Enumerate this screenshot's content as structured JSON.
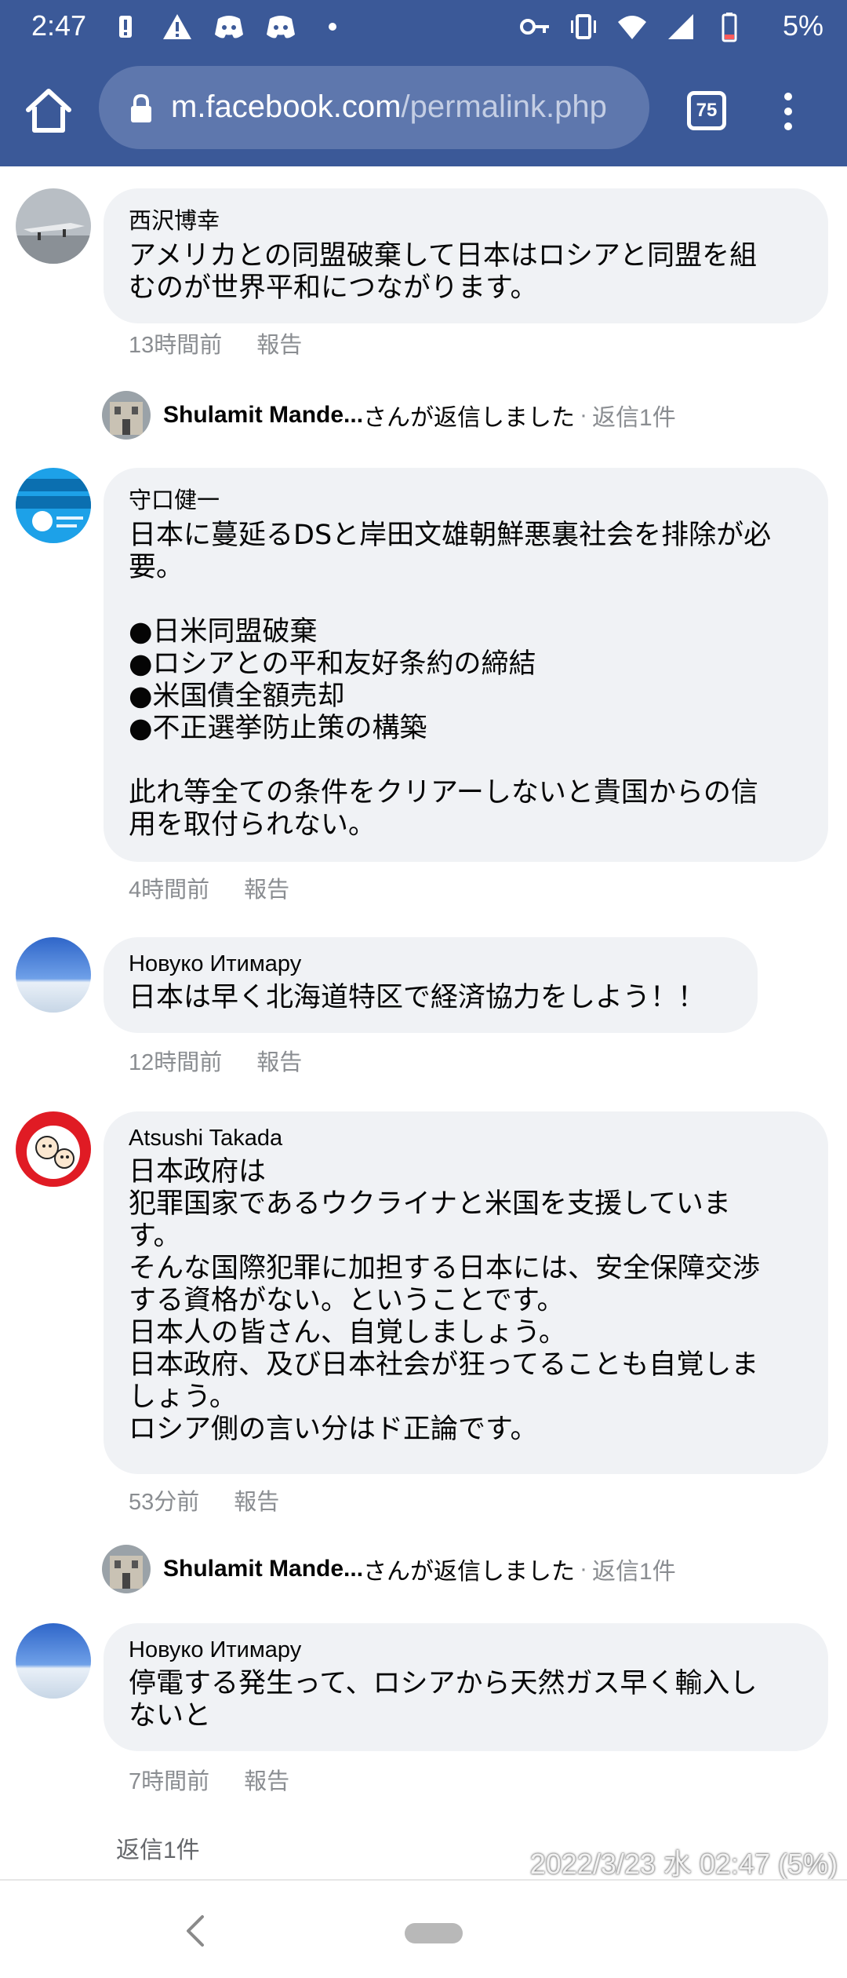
{
  "status_bar": {
    "time": "2:47",
    "battery": "5%",
    "left_icons": [
      "alert-battery-icon",
      "warning-icon",
      "discord-icon",
      "discord-icon",
      "dot-icon"
    ],
    "right_icons": [
      "key-icon",
      "vibrate-icon",
      "wifi-icon",
      "signal-icon",
      "battery-low-icon"
    ]
  },
  "browser": {
    "url_domain": "m.facebook.com",
    "url_path": "/permalink.php",
    "tab_count": "75"
  },
  "comments": [
    {
      "author": "西沢博幸",
      "text": "アメリカとの同盟破棄して日本はロシアと同盟を組\nむのが世界平和につながります。",
      "time": "13時間前",
      "report": "報告"
    },
    {
      "author": "守口健一",
      "text": "日本に蔓延るDSと岸田文雄朝鮮悪裏社会を排除が必\n要。\n\n●日米同盟破棄\n●ロシアとの平和友好条約の締結\n●米国債全額売却\n●不正選挙防止策の構築\n\n此れ等全ての条件をクリアーしないと貴国からの信\n用を取付られない。",
      "time": "4時間前",
      "report": "報告"
    },
    {
      "author": "Новуко Итимару",
      "text": "日本は早く北海道特区で経済協力をしよう！！",
      "time": "12時間前",
      "report": "報告"
    },
    {
      "author": "Atsushi Takada",
      "text": "日本政府は\n犯罪国家であるウクライナと米国を支援していま\nす。\nそんな国際犯罪に加担する日本には、安全保障交渉\nする資格がない。ということです。\n日本人の皆さん、自覚しましょう。\n日本政府、及び日本社会が狂ってることも自覚しま\nしょう。\nロシア側の言い分はド正論です。",
      "time": "53分前",
      "report": "報告"
    },
    {
      "author": "Новуко Итимару",
      "text": "停電する発生って、ロシアから天然ガス早く輸入し\nないと",
      "time": "7時間前",
      "report": "報告"
    }
  ],
  "replies": [
    {
      "name": "Shulamit Mande...",
      "suffix": "さんが返信しました",
      "sep": "·",
      "count": "返信1件"
    },
    {
      "name": "Shulamit Mande...",
      "suffix": "さんが返信しました",
      "sep": "·",
      "count": "返信1件"
    }
  ],
  "more_replies": "返信1件",
  "overlay_timestamp": "2022/3/23 水 02:47 (5%)"
}
